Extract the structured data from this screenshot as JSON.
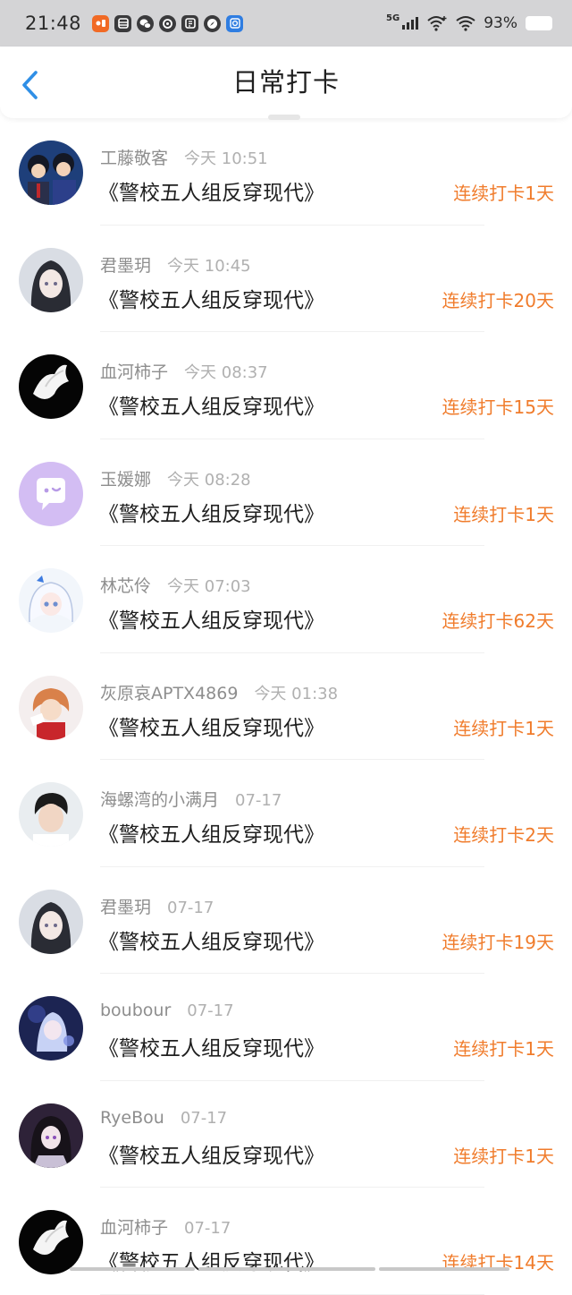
{
  "status_bar": {
    "time": "21:48",
    "network": "5G",
    "battery": "93%"
  },
  "header": {
    "title": "日常打卡"
  },
  "checkins": [
    {
      "user": "工藤敬客",
      "time": "今天 10:51",
      "book": "《警校五人组反穿现代》",
      "streak": "连续打卡1天"
    },
    {
      "user": "君墨玥",
      "time": "今天 10:45",
      "book": "《警校五人组反穿现代》",
      "streak": "连续打卡20天"
    },
    {
      "user": "血河柿子",
      "time": "今天 08:37",
      "book": "《警校五人组反穿现代》",
      "streak": "连续打卡15天"
    },
    {
      "user": "玉媛娜",
      "time": "今天 08:28",
      "book": "《警校五人组反穿现代》",
      "streak": "连续打卡1天"
    },
    {
      "user": "林芯伶",
      "time": "今天 07:03",
      "book": "《警校五人组反穿现代》",
      "streak": "连续打卡62天"
    },
    {
      "user": "灰原哀APTX4869",
      "time": "今天 01:38",
      "book": "《警校五人组反穿现代》",
      "streak": "连续打卡1天"
    },
    {
      "user": "海螺湾的小满月",
      "time": "07-17",
      "book": "《警校五人组反穿现代》",
      "streak": "连续打卡2天"
    },
    {
      "user": "君墨玥",
      "time": "07-17",
      "book": "《警校五人组反穿现代》",
      "streak": "连续打卡19天"
    },
    {
      "user": "boubour",
      "time": "07-17",
      "book": "《警校五人组反穿现代》",
      "streak": "连续打卡1天"
    },
    {
      "user": "RyeBou",
      "time": "07-17",
      "book": "《警校五人组反穿现代》",
      "streak": "连续打卡1天"
    },
    {
      "user": "血河柿子",
      "time": "07-17",
      "book": "《警校五人组反穿现代》",
      "streak": "连续打卡14天"
    }
  ],
  "colors": {
    "accent_blue": "#2f8fe6",
    "streak_orange": "#f07c2c",
    "status_bar_bg": "#d4d4d6"
  },
  "icons": {
    "back": "chevron-left-icon"
  }
}
